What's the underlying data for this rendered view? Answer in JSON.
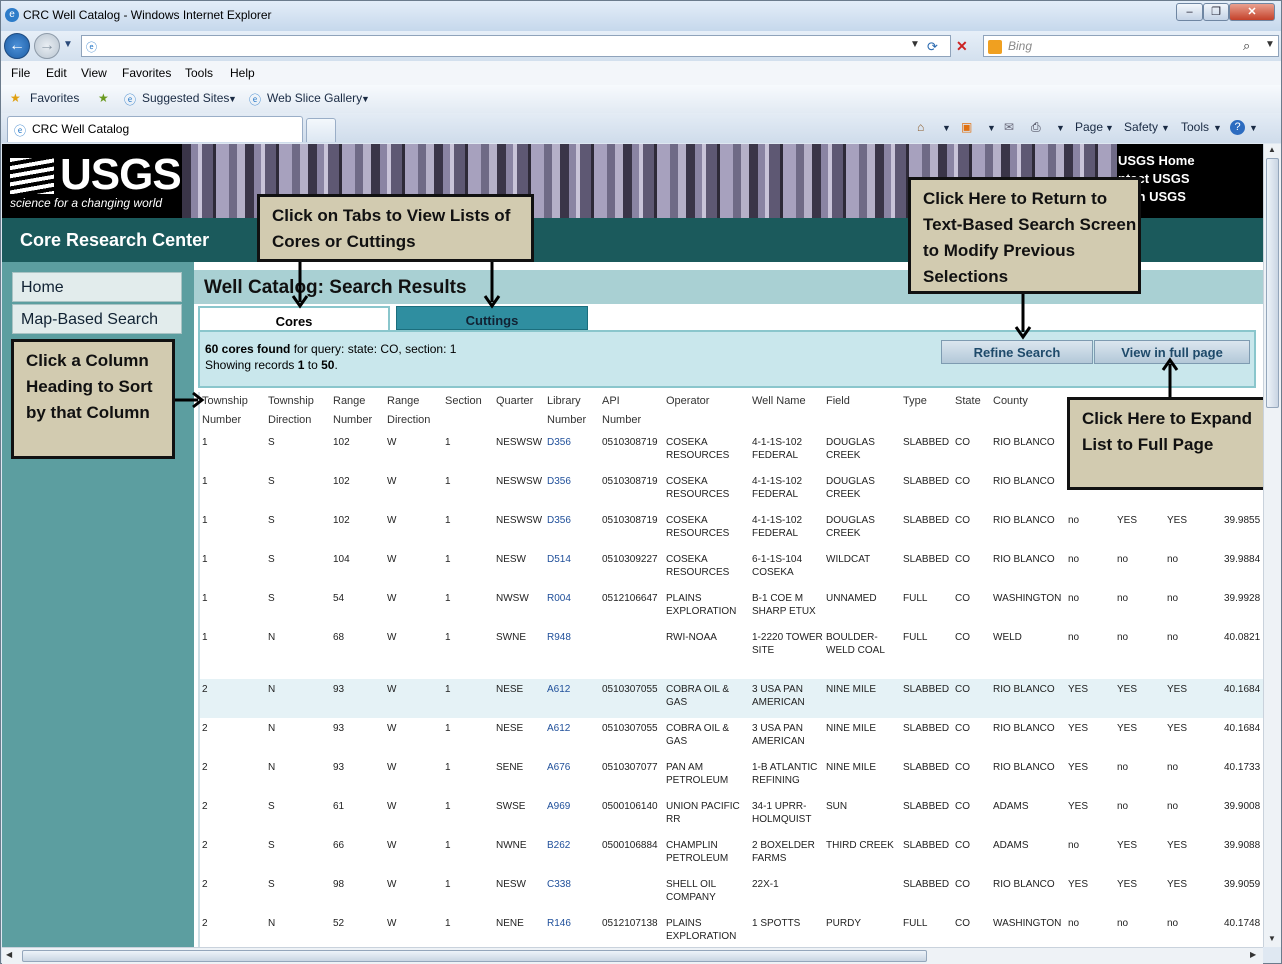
{
  "window": {
    "title": "CRC Well Catalog - Windows Internet Explorer"
  },
  "browser": {
    "search_placeholder": "Bing",
    "menu": [
      "File",
      "Edit",
      "View",
      "Favorites",
      "Tools",
      "Help"
    ],
    "favorites": {
      "label": "Favorites",
      "suggested": "Suggested Sites",
      "gallery": "Web Slice Gallery"
    },
    "tab_title": "CRC Well Catalog",
    "commands": {
      "page": "Page",
      "safety": "Safety",
      "tools": "Tools"
    }
  },
  "site": {
    "logo": "USGS",
    "tagline": "science for a changing world",
    "top_links": [
      "USGS Home",
      "ntact USGS",
      "arch USGS"
    ],
    "center": "Core Research Center",
    "nav": [
      "Home",
      "Map-Based Search"
    ]
  },
  "results": {
    "title": "Well Catalog: Search Results",
    "tabs": [
      "Cores",
      "Cuttings"
    ],
    "count_bold": "60 cores found",
    "query_text": " for query: state: CO, section: 1",
    "showing_prefix": "Showing records ",
    "showing_from": "1",
    "showing_to_word": " to ",
    "showing_to": "50",
    "showing_end": ".",
    "buttons": {
      "refine": "Refine Search",
      "full": "View in full page"
    },
    "columns": [
      [
        "Township",
        "Number"
      ],
      [
        "Township",
        "Direction"
      ],
      [
        "Range",
        "Number"
      ],
      [
        "Range",
        "Direction"
      ],
      [
        "Section",
        ""
      ],
      [
        "Quarter",
        ""
      ],
      [
        "Library",
        "Number"
      ],
      [
        "API",
        "Number"
      ],
      [
        "Operator",
        ""
      ],
      [
        "Well Name",
        ""
      ],
      [
        "Field",
        ""
      ],
      [
        "Type",
        ""
      ],
      [
        "State",
        ""
      ],
      [
        "County",
        ""
      ]
    ],
    "rows": [
      {
        "tn": "1",
        "td": "S",
        "rn": "102",
        "rd": "W",
        "sec": "1",
        "q": "NESWSW",
        "lib": "D356",
        "api": "0510308719",
        "op": "COSEKA RESOURCES",
        "wn": "4-1-1S-102 FEDERAL",
        "fld": "DOUGLAS CREEK",
        "type": "SLABBED",
        "st": "CO",
        "cty": "RIO BLANCO",
        "a": "",
        "b": "",
        "c": "",
        "lat": ""
      },
      {
        "tn": "1",
        "td": "S",
        "rn": "102",
        "rd": "W",
        "sec": "1",
        "q": "NESWSW",
        "lib": "D356",
        "api": "0510308719",
        "op": "COSEKA RESOURCES",
        "wn": "4-1-1S-102 FEDERAL",
        "fld": "DOUGLAS CREEK",
        "type": "SLABBED",
        "st": "CO",
        "cty": "RIO BLANCO",
        "a": "",
        "b": "",
        "c": "",
        "lat": ""
      },
      {
        "tn": "1",
        "td": "S",
        "rn": "102",
        "rd": "W",
        "sec": "1",
        "q": "NESWSW",
        "lib": "D356",
        "api": "0510308719",
        "op": "COSEKA RESOURCES",
        "wn": "4-1-1S-102 FEDERAL",
        "fld": "DOUGLAS CREEK",
        "type": "SLABBED",
        "st": "CO",
        "cty": "RIO BLANCO",
        "a": "no",
        "b": "YES",
        "c": "YES",
        "lat": "39.9855"
      },
      {
        "tn": "1",
        "td": "S",
        "rn": "104",
        "rd": "W",
        "sec": "1",
        "q": "NESW",
        "lib": "D514",
        "api": "0510309227",
        "op": "COSEKA RESOURCES",
        "wn": "6-1-1S-104 COSEKA",
        "fld": "WILDCAT",
        "type": "SLABBED",
        "st": "CO",
        "cty": "RIO BLANCO",
        "a": "no",
        "b": "no",
        "c": "no",
        "lat": "39.9884"
      },
      {
        "tn": "1",
        "td": "S",
        "rn": "54",
        "rd": "W",
        "sec": "1",
        "q": "NWSW",
        "lib": "R004",
        "api": "0512106647",
        "op": "PLAINS EXPLORATION",
        "wn": "B-1 COE M SHARP ETUX",
        "fld": "UNNAMED",
        "type": "FULL",
        "st": "CO",
        "cty": "WASHINGTON",
        "a": "no",
        "b": "no",
        "c": "no",
        "lat": "39.9928"
      },
      {
        "tn": "1",
        "td": "N",
        "rn": "68",
        "rd": "W",
        "sec": "1",
        "q": "SWNE",
        "lib": "R948",
        "api": "",
        "op": "RWI-NOAA",
        "wn": "1-2220 TOWER SITE",
        "fld": "BOULDER-WELD COAL",
        "type": "FULL",
        "st": "CO",
        "cty": "WELD",
        "a": "no",
        "b": "no",
        "c": "no",
        "lat": "40.0821"
      },
      {
        "tn": "2",
        "td": "N",
        "rn": "93",
        "rd": "W",
        "sec": "1",
        "q": "NESE",
        "lib": "A612",
        "api": "0510307055",
        "op": "COBRA OIL & GAS",
        "wn": "3 USA PAN AMERICAN",
        "fld": "NINE MILE",
        "type": "SLABBED",
        "st": "CO",
        "cty": "RIO BLANCO",
        "a": "YES",
        "b": "YES",
        "c": "YES",
        "lat": "40.1684"
      },
      {
        "tn": "2",
        "td": "N",
        "rn": "93",
        "rd": "W",
        "sec": "1",
        "q": "NESE",
        "lib": "A612",
        "api": "0510307055",
        "op": "COBRA OIL & GAS",
        "wn": "3 USA PAN AMERICAN",
        "fld": "NINE MILE",
        "type": "SLABBED",
        "st": "CO",
        "cty": "RIO BLANCO",
        "a": "YES",
        "b": "YES",
        "c": "YES",
        "lat": "40.1684"
      },
      {
        "tn": "2",
        "td": "N",
        "rn": "93",
        "rd": "W",
        "sec": "1",
        "q": "SENE",
        "lib": "A676",
        "api": "0510307077",
        "op": "PAN AM PETROLEUM",
        "wn": "1-B ATLANTIC REFINING",
        "fld": "NINE MILE",
        "type": "SLABBED",
        "st": "CO",
        "cty": "RIO BLANCO",
        "a": "YES",
        "b": "no",
        "c": "no",
        "lat": "40.1733"
      },
      {
        "tn": "2",
        "td": "S",
        "rn": "61",
        "rd": "W",
        "sec": "1",
        "q": "SWSE",
        "lib": "A969",
        "api": "0500106140",
        "op": "UNION PACIFIC RR",
        "wn": "34-1 UPRR-HOLMQUIST",
        "fld": "SUN",
        "type": "SLABBED",
        "st": "CO",
        "cty": "ADAMS",
        "a": "YES",
        "b": "no",
        "c": "no",
        "lat": "39.9008"
      },
      {
        "tn": "2",
        "td": "S",
        "rn": "66",
        "rd": "W",
        "sec": "1",
        "q": "NWNE",
        "lib": "B262",
        "api": "0500106884",
        "op": "CHAMPLIN PETROLEUM",
        "wn": "2 BOXELDER FARMS",
        "fld": "THIRD CREEK",
        "type": "SLABBED",
        "st": "CO",
        "cty": "ADAMS",
        "a": "no",
        "b": "YES",
        "c": "YES",
        "lat": "39.9088"
      },
      {
        "tn": "2",
        "td": "S",
        "rn": "98",
        "rd": "W",
        "sec": "1",
        "q": "NESW",
        "lib": "C338",
        "api": "",
        "op": "SHELL OIL COMPANY",
        "wn": "22X-1",
        "fld": "",
        "type": "SLABBED",
        "st": "CO",
        "cty": "RIO BLANCO",
        "a": "YES",
        "b": "YES",
        "c": "YES",
        "lat": "39.9059"
      },
      {
        "tn": "2",
        "td": "N",
        "rn": "52",
        "rd": "W",
        "sec": "1",
        "q": "NENE",
        "lib": "R146",
        "api": "0512107138",
        "op": "PLAINS EXPLORATION",
        "wn": "1 SPOTTS",
        "fld": "PURDY",
        "type": "FULL",
        "st": "CO",
        "cty": "WASHINGTON",
        "a": "no",
        "b": "no",
        "c": "no",
        "lat": "40.1748"
      }
    ]
  },
  "callouts": {
    "tabs": "Click on Tabs to View Lists of Cores or Cuttings",
    "refine": "Click Here to Return to Text-Based Search Screen to Modify Previous Selections",
    "column": "Click a Column Heading to Sort by that Column",
    "full": "Click Here to Expand List to Full Page"
  }
}
